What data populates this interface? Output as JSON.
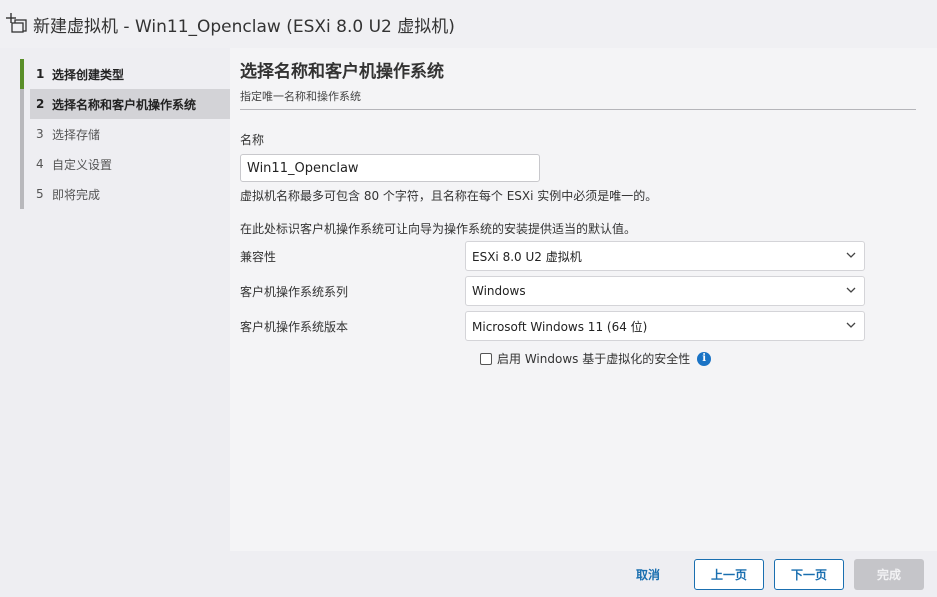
{
  "window": {
    "title": "新建虚拟机 - Win11_Openclaw (ESXi 8.0 U2 虚拟机)",
    "icon": "new-vm-icon"
  },
  "steps": [
    {
      "num": "1",
      "label": "选择创建类型",
      "state": "done"
    },
    {
      "num": "2",
      "label": "选择名称和客户机操作系统",
      "state": "active"
    },
    {
      "num": "3",
      "label": "选择存储",
      "state": "pending"
    },
    {
      "num": "4",
      "label": "自定义设置",
      "state": "pending"
    },
    {
      "num": "5",
      "label": "即将完成",
      "state": "pending"
    }
  ],
  "main": {
    "title": "选择名称和客户机操作系统",
    "subtitle": "指定唯一名称和操作系统",
    "name_label": "名称",
    "name_value": "Win11_Openclaw",
    "name_hint": "虚拟机名称最多可包含 80 个字符，且名称在每个 ESXi 实例中必须是唯一的。",
    "os_hint": "在此处标识客户机操作系统可让向导为操作系统的安装提供适当的默认值。",
    "fields": [
      {
        "label": "兼容性",
        "value": "ESXi 8.0 U2 虚拟机"
      },
      {
        "label": "客户机操作系统系列",
        "value": "Windows"
      },
      {
        "label": "客户机操作系统版本",
        "value": "Microsoft Windows 11 (64 位)"
      }
    ],
    "vbs_checkbox": {
      "label": "启用 Windows 基于虚拟化的安全性",
      "checked": false
    }
  },
  "footer": {
    "cancel": "取消",
    "back": "上一页",
    "next": "下一页",
    "finish": "完成"
  },
  "colors": {
    "accent": "#1a6fb0",
    "step_done": "#5a8f29",
    "info": "#1a73c5"
  }
}
